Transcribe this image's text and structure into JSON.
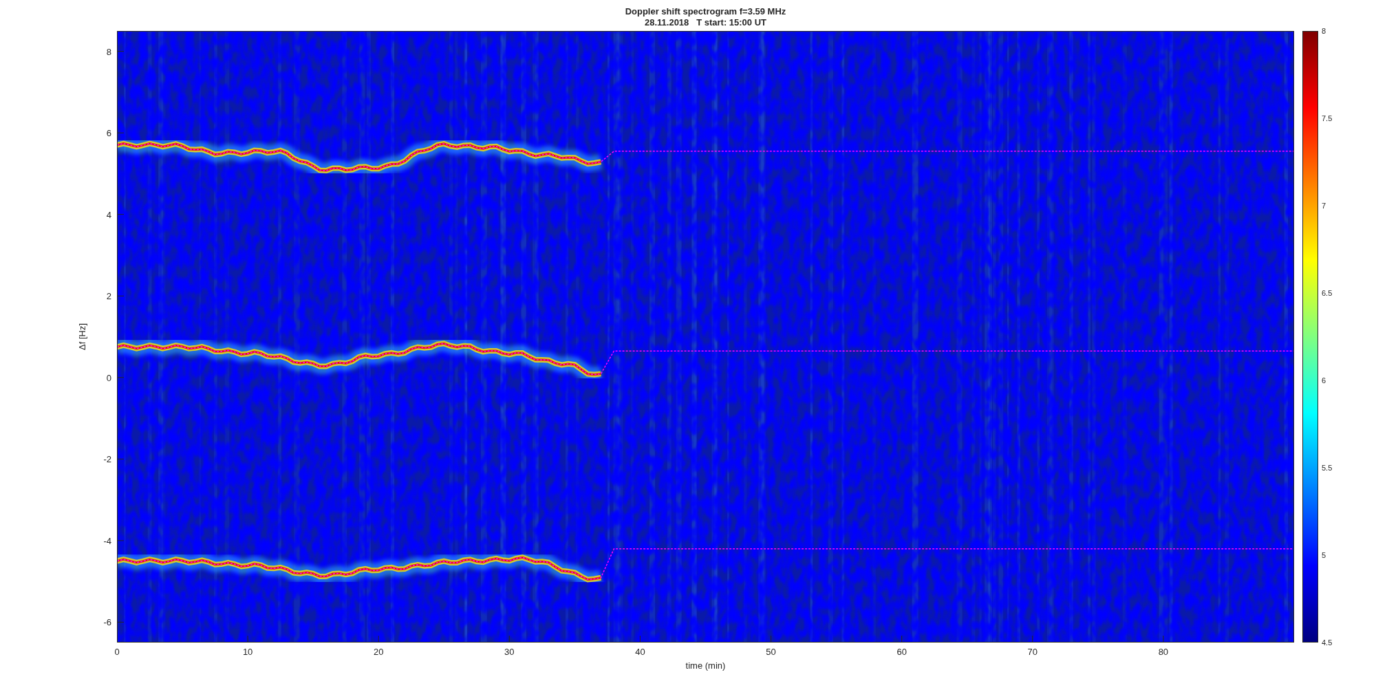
{
  "figure": {
    "title": "Doppler shift spectrogram f=3.59 MHz",
    "subtitle": "28.11.2018   T start: 15:00 UT"
  },
  "axes": {
    "xlabel": "time (min)",
    "ylabel": "Δf [Hz]",
    "xticks": [
      "0",
      "10",
      "20",
      "30",
      "40",
      "50",
      "60",
      "70",
      "80"
    ],
    "yticks": [
      "8",
      "6",
      "4",
      "2",
      "0",
      "-2",
      "-4",
      "-6"
    ]
  },
  "colorbar": {
    "ticks": [
      "8",
      "7.5",
      "7",
      "6.5",
      "6",
      "5.5",
      "5",
      "4.5"
    ]
  }
}
